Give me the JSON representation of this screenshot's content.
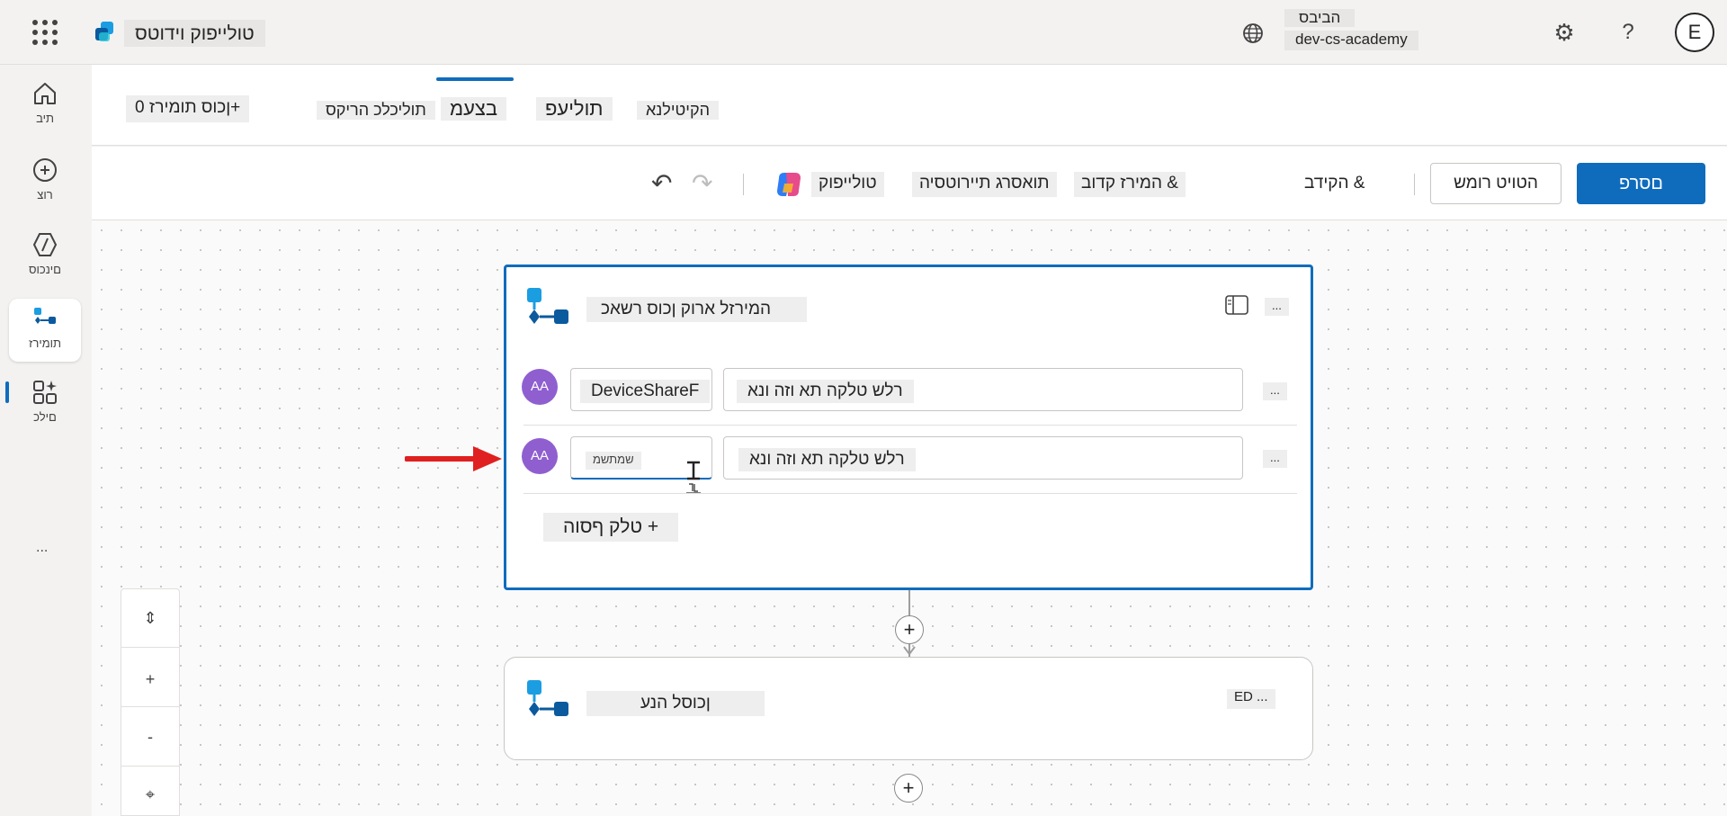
{
  "app": {
    "name": "טולייפוק וידוטס",
    "environment_label": "הביבס",
    "environment_name": "dev-cs-academy",
    "user_initial": "E"
  },
  "rail": {
    "items": [
      {
        "label": "תיב",
        "icon": "home-icon"
      },
      {
        "label": "רוצ",
        "icon": "create-icon"
      },
      {
        "label": "םינכוס",
        "icon": "agents-icon"
      },
      {
        "label": "תומירז",
        "icon": "flows-icon"
      },
      {
        "label": "םילכ",
        "icon": "tools-icon"
      }
    ],
    "more": "..."
  },
  "header": {
    "solutions_pill": "ןכוס תומירז 0+",
    "tabs": [
      {
        "label": "תוליכלכ הריקס"
      },
      {
        "label": "בצעמ"
      },
      {
        "label": "תוליעפ"
      },
      {
        "label": "הקיטילנא"
      }
    ],
    "selected_tab": "בצעמ"
  },
  "toolbar": {
    "publish": "םסרפ",
    "test": "הטויט רומש",
    "insert_variable": "הקידב &",
    "flow_checker": "המירז קדוב &",
    "versions": "תואסרג תיירוטסיה",
    "copilot": "טולייפוק"
  },
  "flow": {
    "node1": {
      "title": "המירזל ארוק ןכוס רשאכ",
      "menu": "...",
      "rows": [
        {
          "avatar": "AA",
          "type_value": "DeviceShareF",
          "text_value": "רלש טלקה תא וזה ונא",
          "menu": "..."
        },
        {
          "avatar": "AA",
          "type_placeholder": "שמתשמ",
          "text_value": "רלש טלקה תא וזה ונא",
          "menu": "..."
        }
      ],
      "add_input": "טלק ףסוה +"
    },
    "node2": {
      "title": "ןכוסל הנע",
      "menu_label": "ED ..."
    }
  },
  "zoom": {
    "fit": "⇕",
    "zoom_in": "+",
    "zoom_out": "-",
    "reset": "⌖"
  },
  "colors": {
    "accent": "#0f6cbd",
    "avatar": "#8f5fd0",
    "arrow": "#e02020"
  }
}
